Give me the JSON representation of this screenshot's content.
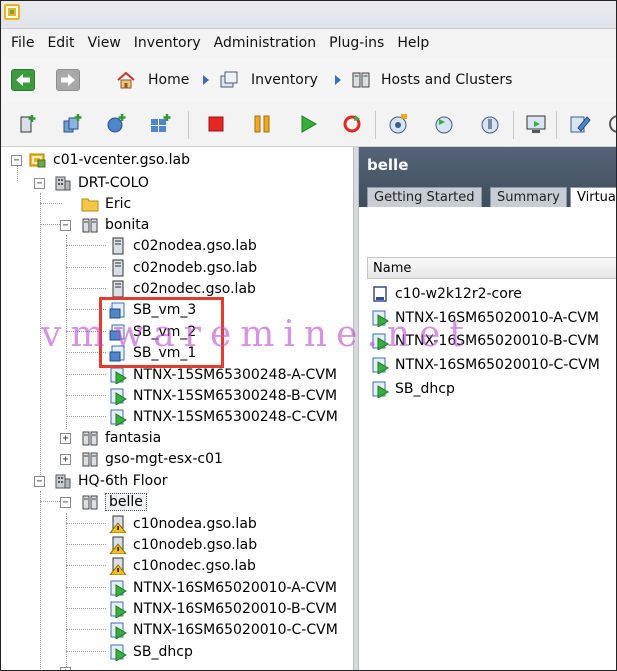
{
  "menu": {
    "items": [
      "File",
      "Edit",
      "View",
      "Inventory",
      "Administration",
      "Plug-ins",
      "Help"
    ]
  },
  "nav": {
    "breadcrumbs": [
      "Home",
      "Inventory",
      "Hosts and Clusters"
    ]
  },
  "tree": {
    "vcenter": "c01-vcenter.gso.lab",
    "datacenter1": "DRT-COLO",
    "folder_eric": "Eric",
    "cluster_bonita": "bonita",
    "bonita_hosts": [
      "c02nodea.gso.lab",
      "c02nodeb.gso.lab",
      "c02nodec.gso.lab"
    ],
    "bonita_vms": [
      "SB_vm_3",
      "SB_vm_2",
      "SB_vm_1",
      "NTNX-15SM65300248-A-CVM",
      "NTNX-15SM65300248-B-CVM",
      "NTNX-15SM65300248-C-CVM"
    ],
    "cluster_fantasia": "fantasia",
    "host_mgt": "gso-mgt-esx-c01",
    "datacenter2": "HQ-6th Floor",
    "cluster_belle": "belle",
    "belle_hosts": [
      "c10nodea.gso.lab",
      "c10nodeb.gso.lab",
      "c10nodec.gso.lab"
    ],
    "belle_vms": [
      "NTNX-16SM65020010-A-CVM",
      "NTNX-16SM65020010-B-CVM",
      "NTNX-16SM65020010-C-CVM",
      "SB_dhcp"
    ]
  },
  "right_panel": {
    "title": "belle",
    "tabs": [
      "Getting Started",
      "Summary",
      "Virtua"
    ],
    "column_header": "Name",
    "items": [
      "c10-w2k12r2-core",
      "NTNX-16SM65020010-A-CVM",
      "NTNX-16SM65020010-B-CVM",
      "NTNX-16SM65020010-C-CVM",
      "SB_dhcp"
    ]
  },
  "watermark": "vmwaremine.net",
  "colors": {
    "annotation_box": "#e63a2e",
    "watermark": "#be50d2",
    "header_bg": "#3f4d5e"
  }
}
